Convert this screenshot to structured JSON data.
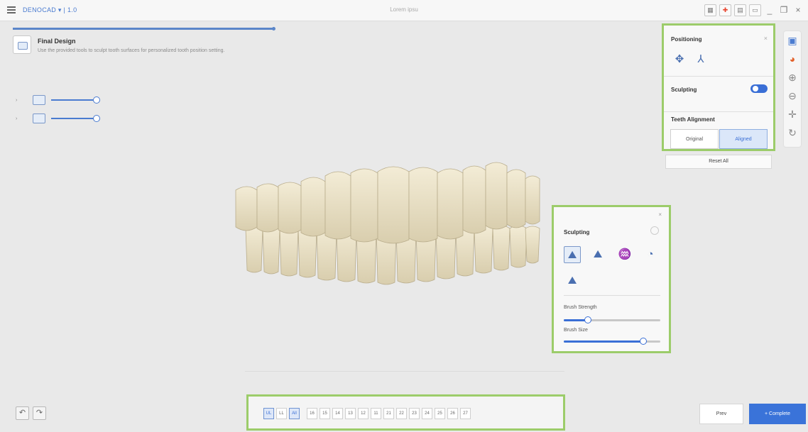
{
  "titlebar": {
    "app_name": "DENOCAD ▾ | 1.0",
    "center_title": "Lorem ipsu",
    "icons": [
      "grid-view-icon",
      "crosshair-icon",
      "layout-icon",
      "window-icon"
    ],
    "minimize": "_",
    "restore": "❐",
    "close": "×"
  },
  "progress": {
    "fraction": 1.0
  },
  "step": {
    "title": "Final Design",
    "description": "Use the provided tools to sculpt tooth surfaces for personalized tooth position setting."
  },
  "visibility": [
    {
      "arrow": "›",
      "level": 1.0
    },
    {
      "arrow": "›",
      "level": 1.0
    }
  ],
  "right_tools": [
    "select-icon",
    "color-icon",
    "zoom-in-icon",
    "zoom-out-icon",
    "pan-icon",
    "rotate-icon"
  ],
  "positioning": {
    "title": "Positioning",
    "close": "×",
    "sculpting_label": "Sculpting",
    "sculpting_on": true,
    "alignment_title": "Teeth Alignment",
    "options": [
      "Original",
      "Aligned"
    ],
    "selected": "Aligned",
    "reset_label": "Reset All"
  },
  "sculpt": {
    "close": "×",
    "title": "Sculpting",
    "tools": [
      "add-icon",
      "remove-icon",
      "smooth-icon",
      "morph-icon",
      "flatten-icon"
    ],
    "active_tool": 0,
    "brush_strength_label": "Brush Strength",
    "brush_strength": 0.25,
    "brush_size_label": "Brush Size",
    "brush_size": 0.82
  },
  "tooth_bar": {
    "view_labels": [
      "UL",
      "LL"
    ],
    "all_label": "All",
    "teeth": [
      "16",
      "15",
      "14",
      "13",
      "12",
      "11",
      "21",
      "22",
      "23",
      "24",
      "25",
      "26",
      "27"
    ],
    "selected": "All"
  },
  "bottom": {
    "undo": "↶",
    "redo": "↷",
    "prev_label": "Prev",
    "complete_label": "+ Complete"
  },
  "colors": {
    "accent": "#3a73d9",
    "highlight_outline": "#9ccc6a",
    "tooth": "#e9e0c7"
  }
}
